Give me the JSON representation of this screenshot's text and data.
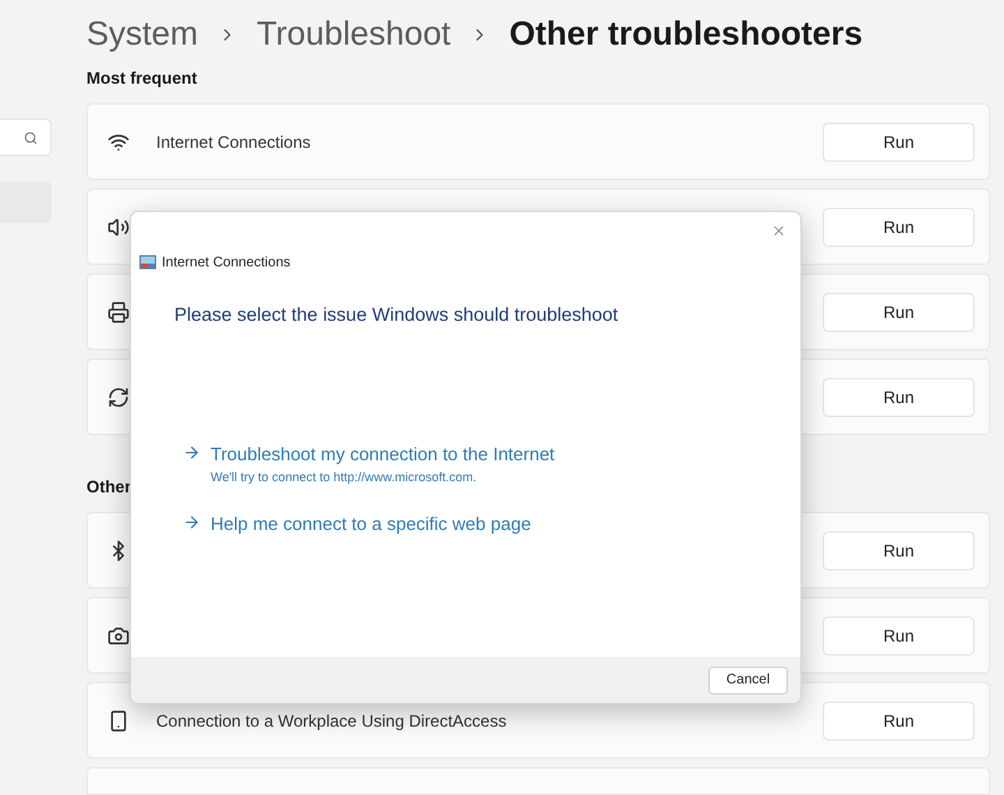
{
  "breadcrumb": [
    "System",
    "Troubleshoot",
    "Other troubleshooters"
  ],
  "sections": [
    {
      "heading": "Most frequent",
      "rows": [
        {
          "name": "Internet Connections",
          "button": "Run"
        },
        {
          "button": "Run"
        },
        {
          "button": "Run"
        },
        {
          "button": "Run"
        }
      ]
    },
    {
      "heading": "Other",
      "rows": [
        {
          "button": "Run"
        },
        {
          "button": "Run"
        },
        {
          "name": "Connection to a Workplace Using DirectAccess",
          "button": "Run"
        }
      ]
    }
  ],
  "dialog": {
    "title": "Internet Connections",
    "heading": "Please select the issue Windows should troubleshoot",
    "options": [
      {
        "label": "Troubleshoot my connection to the Internet",
        "description": "We'll try to connect to http://www.microsoft.com."
      },
      {
        "label": "Help me connect to a specific web page"
      }
    ],
    "button": "Cancel"
  }
}
